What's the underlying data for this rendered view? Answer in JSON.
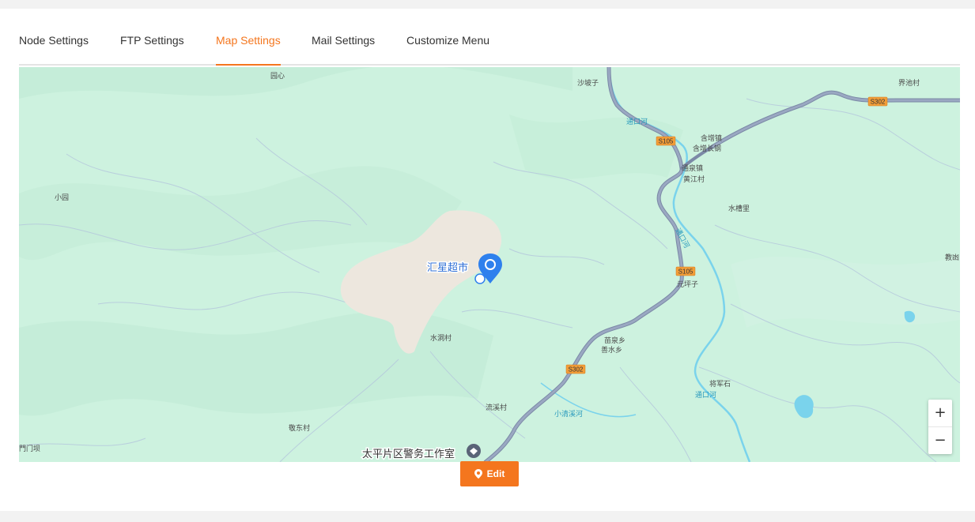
{
  "tabs": [
    {
      "label": "Node Settings"
    },
    {
      "label": "FTP Settings"
    },
    {
      "label": "Map Settings",
      "active": true
    },
    {
      "label": "Mail Settings"
    },
    {
      "label": "Customize Menu"
    }
  ],
  "map": {
    "labels": {
      "village_yuanxin": "园心",
      "village_shaboz": "沙坡子",
      "village_jiechi": "界池村",
      "river_top": "通口河",
      "road_s105_top": "S105",
      "road_s302_right": "S302",
      "town_hanzeng": "含增镇",
      "town_hanzengchang": "含增长钢",
      "town_tongquan": "通泉镇",
      "village_huangjiang": "黄江村",
      "village_xiaoyuan": "小园",
      "place_shuicaoli": "水槽里",
      "river_mid": "通口河",
      "place_jiaoyu": "教凼",
      "marker_supermarket": "汇星超市",
      "road_s105_mid": "S105",
      "place_yuanpingzi": "元坪子",
      "village_shuidong": "水洞村",
      "town_chuquan": "苗泉乡",
      "town_shanshui": "善水乡",
      "road_s302_bottom": "S302",
      "place_jiangjunshi": "将军石",
      "river_bottom": "通口河",
      "village_liuxi": "流溪村",
      "river_xiaoqingxi": "小清溪河",
      "village_jingdong": "敬东村",
      "place_menba": "門门坝",
      "marker_police": "太平片区警务工作室"
    },
    "zoom_in": "+",
    "zoom_out": "−"
  },
  "edit_button": {
    "label": "Edit"
  },
  "colors": {
    "accent": "#f4761e",
    "map_green": "#cdf2df",
    "road": "#8493ad",
    "river": "#7ad3ec",
    "marker_blue": "#2f80ed"
  }
}
